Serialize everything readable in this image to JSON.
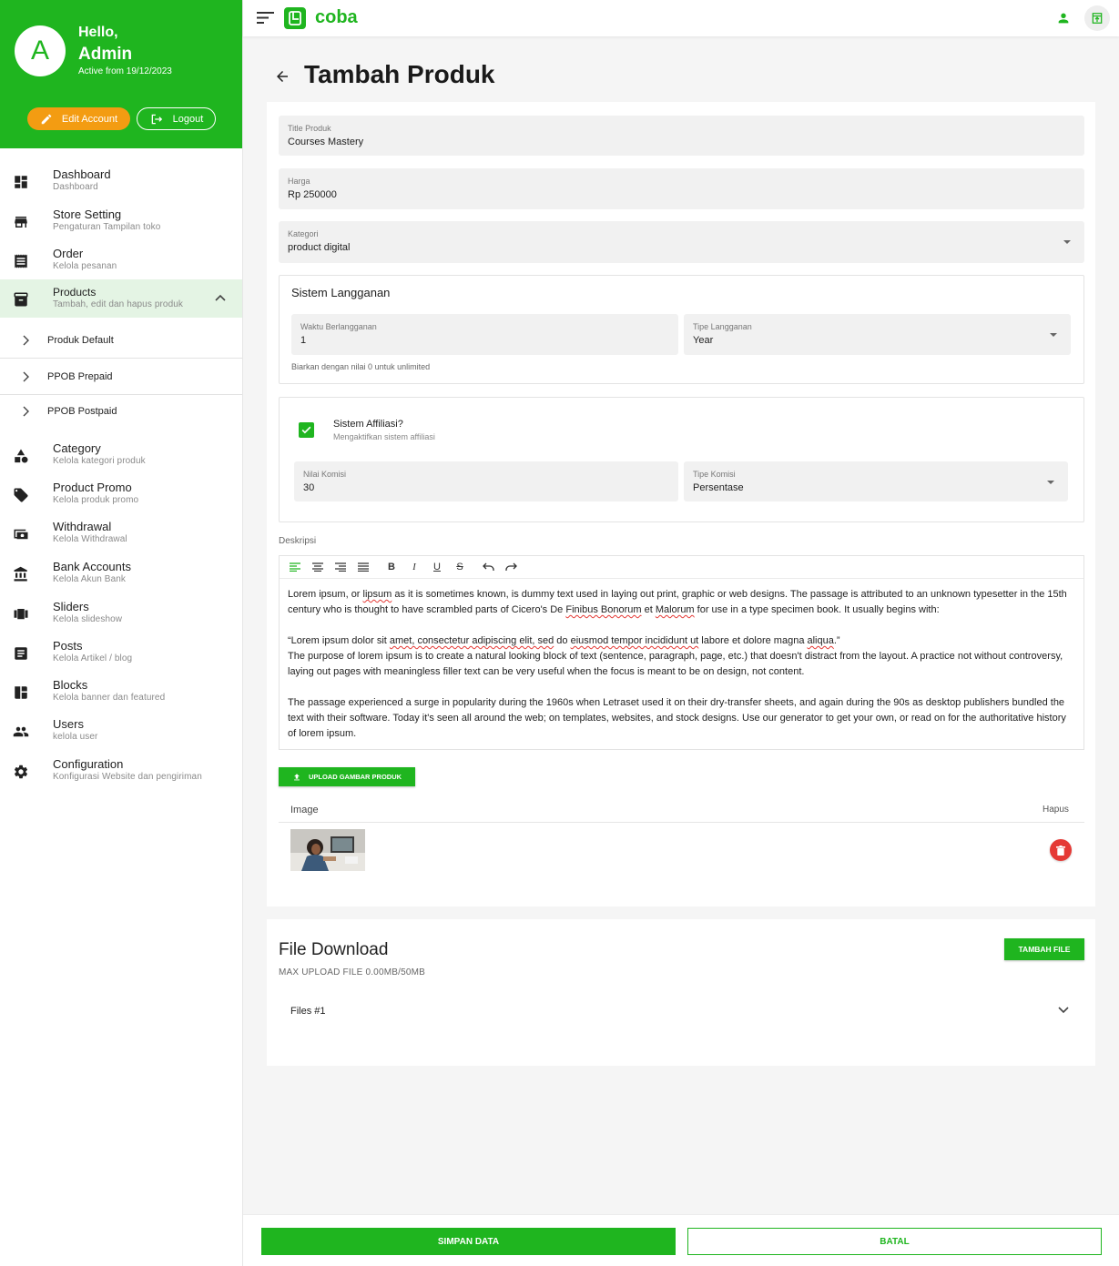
{
  "profile": {
    "avatar_letter": "A",
    "greeting": "Hello,",
    "name": "Admin",
    "active_from": "Active from 19/12/2023",
    "edit_label": "Edit Account",
    "logout_label": "Logout"
  },
  "sidebar": {
    "items": [
      {
        "title": "Dashboard",
        "subtitle": "Dashboard",
        "icon": "dashboard-icon"
      },
      {
        "title": "Store Setting",
        "subtitle": "Pengaturan Tampilan toko",
        "icon": "store-icon"
      },
      {
        "title": "Order",
        "subtitle": "Kelola pesanan",
        "icon": "receipt-icon"
      },
      {
        "title": "Products",
        "subtitle": "Tambah, edit dan hapus produk",
        "icon": "archive-icon"
      },
      {
        "title": "Category",
        "subtitle": "Kelola kategori produk",
        "icon": "category-icon"
      },
      {
        "title": "Product Promo",
        "subtitle": "Kelola produk promo",
        "icon": "tag-icon"
      },
      {
        "title": "Withdrawal",
        "subtitle": "Kelola Withdrawal",
        "icon": "wallet-icon"
      },
      {
        "title": "Bank Accounts",
        "subtitle": "Kelola Akun Bank",
        "icon": "bank-icon"
      },
      {
        "title": "Sliders",
        "subtitle": "Kelola slideshow",
        "icon": "slider-icon"
      },
      {
        "title": "Posts",
        "subtitle": "Kelola Artikel / blog",
        "icon": "article-icon"
      },
      {
        "title": "Blocks",
        "subtitle": "Kelola banner dan featured",
        "icon": "blocks-icon"
      },
      {
        "title": "Users",
        "subtitle": "kelola user",
        "icon": "users-icon"
      },
      {
        "title": "Configuration",
        "subtitle": "Konfigurasi Website dan pengiriman",
        "icon": "gear-icon"
      }
    ],
    "product_subitems": [
      "Produk Default",
      "PPOB Prepaid",
      "PPOB Postpaid"
    ]
  },
  "topbar": {
    "brand": "coba"
  },
  "page": {
    "title": "Tambah Produk"
  },
  "form": {
    "title": {
      "label": "Title Produk",
      "value": "Courses Mastery"
    },
    "price": {
      "label": "Harga",
      "value": "Rp 250000"
    },
    "category": {
      "label": "Kategori",
      "value": "product digital"
    },
    "subscription": {
      "heading": "Sistem Langganan",
      "duration": {
        "label": "Waktu Berlangganan",
        "value": "1"
      },
      "type": {
        "label": "Tipe Langganan",
        "value": "Year"
      },
      "hint": "Biarkan dengan nilai 0 untuk unlimited"
    },
    "affiliate": {
      "checked": true,
      "label": "Sistem Affiliasi?",
      "sublabel": "Mengaktifkan sistem affiliasi",
      "commission_value": {
        "label": "Nilai Komisi",
        "value": "30"
      },
      "commission_type": {
        "label": "Tipe Komisi",
        "value": "Persentase"
      }
    },
    "description": {
      "label": "Deskripsi",
      "toolbar": [
        "align-left",
        "align-center",
        "align-right",
        "align-justify",
        "bold",
        "italic",
        "underline",
        "strikethrough",
        "undo",
        "redo"
      ]
    },
    "upload_label": "UPLOAD GAMBAR PRODUK",
    "image_table": {
      "col_image": "Image",
      "col_delete": "Hapus"
    }
  },
  "file_download": {
    "title": "File Download",
    "subtitle": "MAX UPLOAD FILE 0.00MB/50MB",
    "add_label": "TAMBAH FILE",
    "files": [
      "Files #1"
    ]
  },
  "actions": {
    "save": "SIMPAN DATA",
    "cancel": "BATAL"
  },
  "colors": {
    "primary": "#1fb51f",
    "accent": "#f39c12",
    "danger": "#e53935"
  }
}
